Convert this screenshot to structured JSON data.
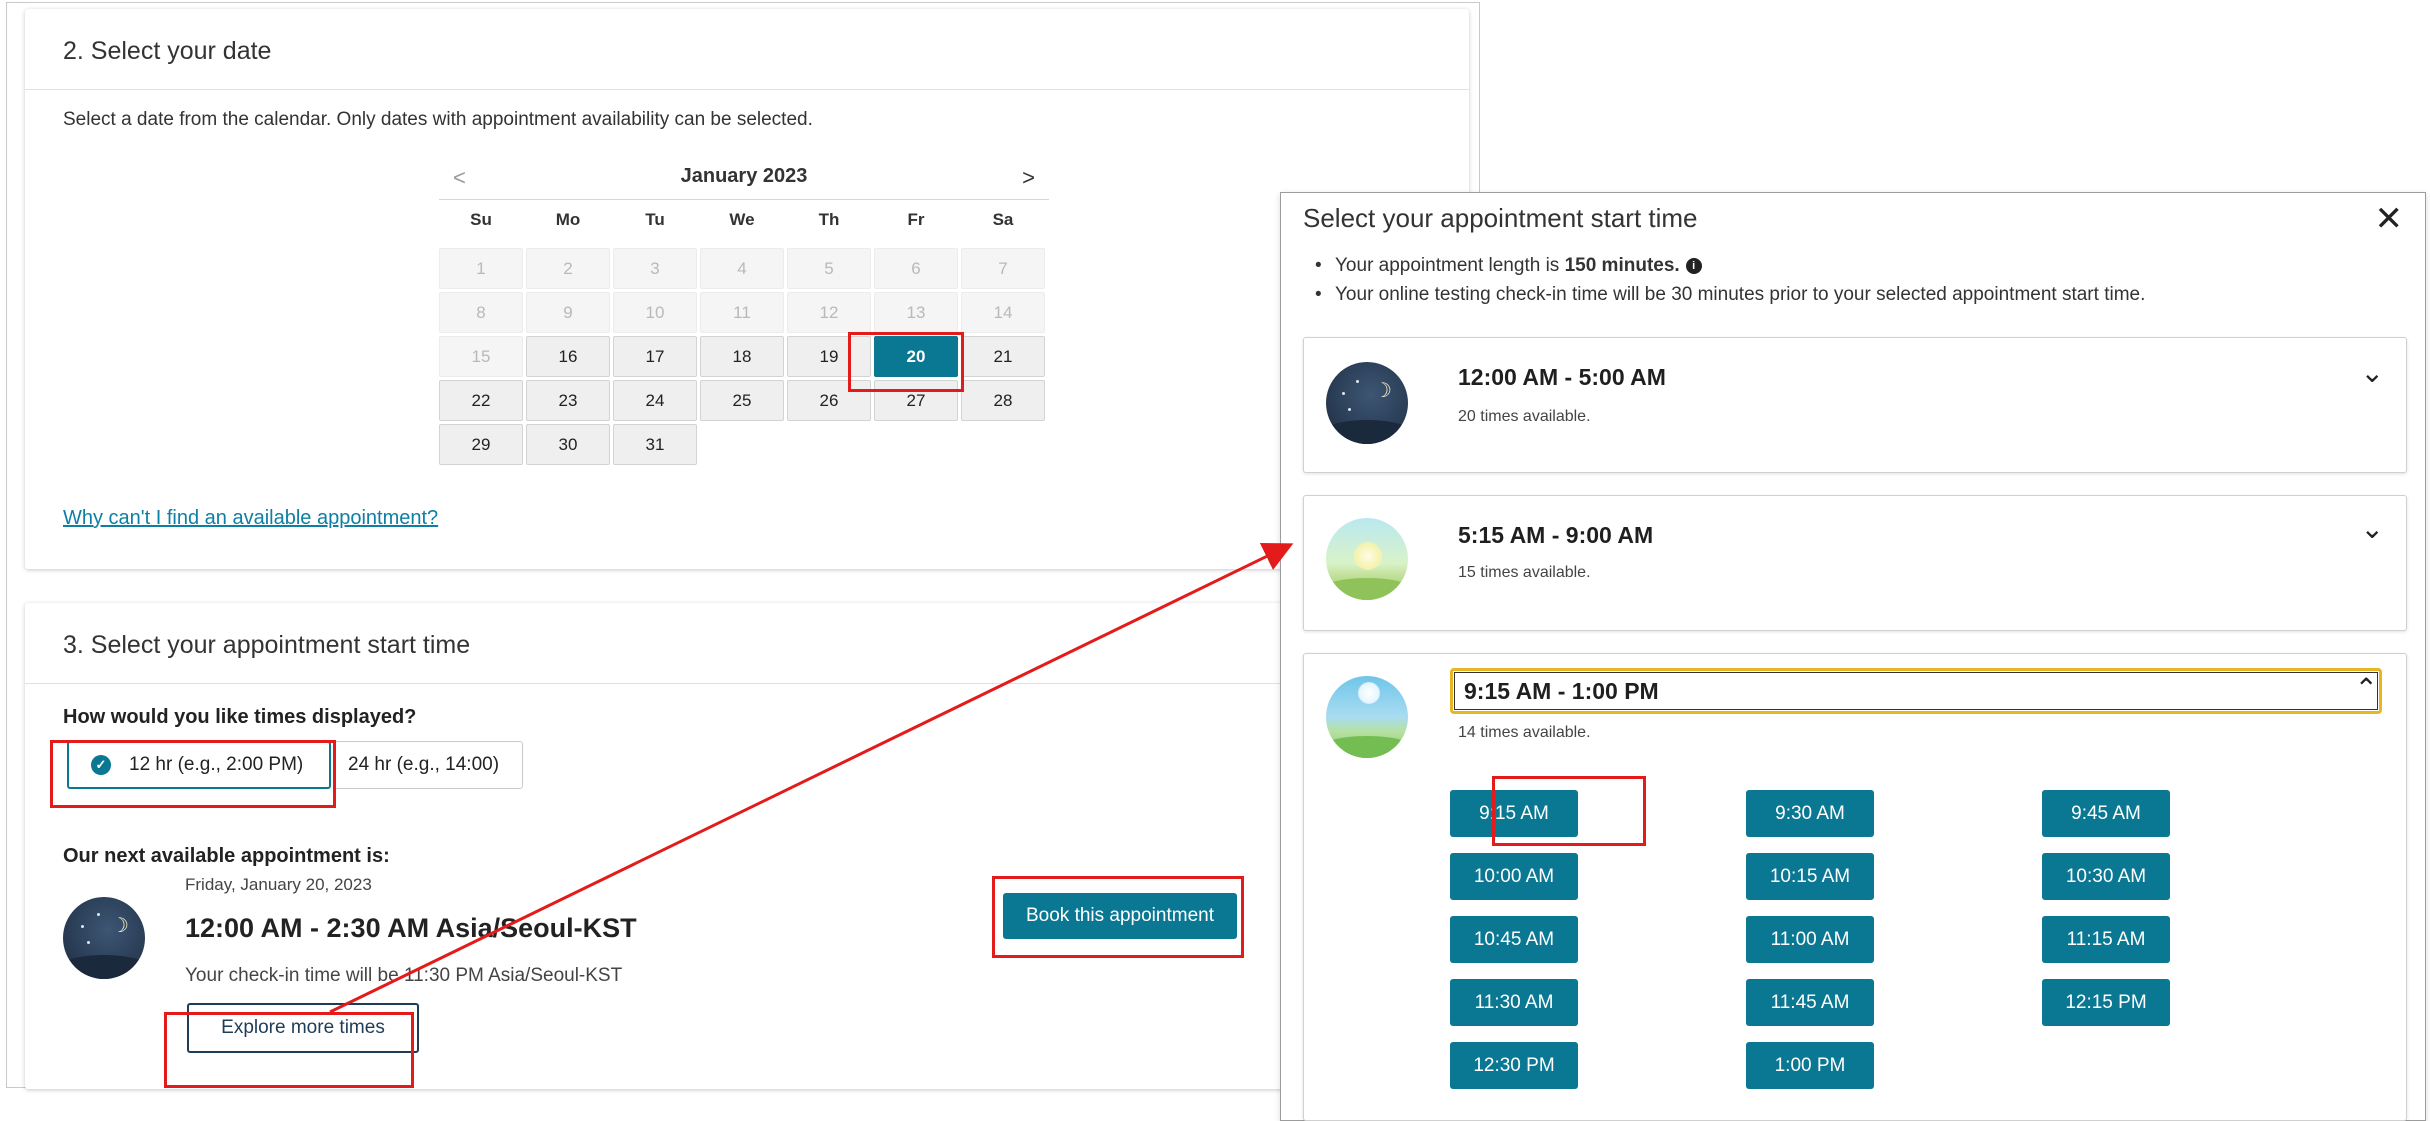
{
  "date_section": {
    "title": "2. Select your date",
    "helper": "Select a date from the calendar. Only dates with appointment availability can be selected.",
    "calendar": {
      "prev": "<",
      "next": ">",
      "month": "January 2023",
      "days_of_week": [
        "Su",
        "Mo",
        "Tu",
        "We",
        "Th",
        "Fr",
        "Sa"
      ],
      "days": [
        {
          "d": "1",
          "state": "disabled"
        },
        {
          "d": "2",
          "state": "disabled"
        },
        {
          "d": "3",
          "state": "disabled"
        },
        {
          "d": "4",
          "state": "disabled"
        },
        {
          "d": "5",
          "state": "disabled"
        },
        {
          "d": "6",
          "state": "disabled"
        },
        {
          "d": "7",
          "state": "disabled"
        },
        {
          "d": "8",
          "state": "disabled"
        },
        {
          "d": "9",
          "state": "disabled"
        },
        {
          "d": "10",
          "state": "disabled"
        },
        {
          "d": "11",
          "state": "disabled"
        },
        {
          "d": "12",
          "state": "disabled"
        },
        {
          "d": "13",
          "state": "disabled"
        },
        {
          "d": "14",
          "state": "disabled"
        },
        {
          "d": "15",
          "state": "disabled"
        },
        {
          "d": "16",
          "state": "enabled"
        },
        {
          "d": "17",
          "state": "enabled"
        },
        {
          "d": "18",
          "state": "enabled"
        },
        {
          "d": "19",
          "state": "enabled"
        },
        {
          "d": "20",
          "state": "selected"
        },
        {
          "d": "21",
          "state": "enabled"
        },
        {
          "d": "22",
          "state": "enabled"
        },
        {
          "d": "23",
          "state": "enabled"
        },
        {
          "d": "24",
          "state": "enabled"
        },
        {
          "d": "25",
          "state": "enabled"
        },
        {
          "d": "26",
          "state": "enabled"
        },
        {
          "d": "27",
          "state": "enabled"
        },
        {
          "d": "28",
          "state": "enabled"
        },
        {
          "d": "29",
          "state": "enabled"
        },
        {
          "d": "30",
          "state": "enabled"
        },
        {
          "d": "31",
          "state": "enabled"
        }
      ]
    },
    "why_link": "Why can't I find an available appointment?"
  },
  "time_section": {
    "title": "3. Select your appointment start time",
    "display_question": "How would you like times displayed?",
    "option_12": "12 hr (e.g., 2:00 PM)",
    "option_24": "24 hr (e.g., 14:00)",
    "next_label": "Our next available appointment is:",
    "next_date": "Friday, January 20, 2023",
    "next_time": "12:00 AM - 2:30 AM Asia/Seoul-KST",
    "checkin": "Your check-in time will be 11:30 PM Asia/Seoul-KST",
    "explore_button": "Explore more times",
    "book_button": "Book this appointment"
  },
  "modal": {
    "title": "Select your appointment start time",
    "close": "✕",
    "bullet1_prefix": "Your appointment length is ",
    "bullet1_bold": "150 minutes.",
    "bullet2": "Your online testing check-in time will be 30 minutes prior to your selected appointment start time.",
    "slots": [
      {
        "range": "12:00 AM - 5:00 AM",
        "count": "20 times available.",
        "icon": "night-icon",
        "expanded": false
      },
      {
        "range": "5:15 AM - 9:00 AM",
        "count": "15 times available.",
        "icon": "sunrise-icon",
        "expanded": false
      },
      {
        "range": "9:15 AM - 1:00 PM",
        "count": "14 times available.",
        "icon": "day-icon",
        "expanded": true
      }
    ],
    "times": [
      "9:15 AM",
      "9:30 AM",
      "9:45 AM",
      "10:00 AM",
      "10:15 AM",
      "10:30 AM",
      "10:45 AM",
      "11:00 AM",
      "11:15 AM",
      "11:30 AM",
      "11:45 AM",
      "12:15 PM",
      "12:30 PM",
      "1:00 PM"
    ]
  },
  "colors": {
    "accent": "#0b7893",
    "highlight": "#e31b1b",
    "focus_ring": "#e8b624",
    "link": "#0d7fa4"
  }
}
